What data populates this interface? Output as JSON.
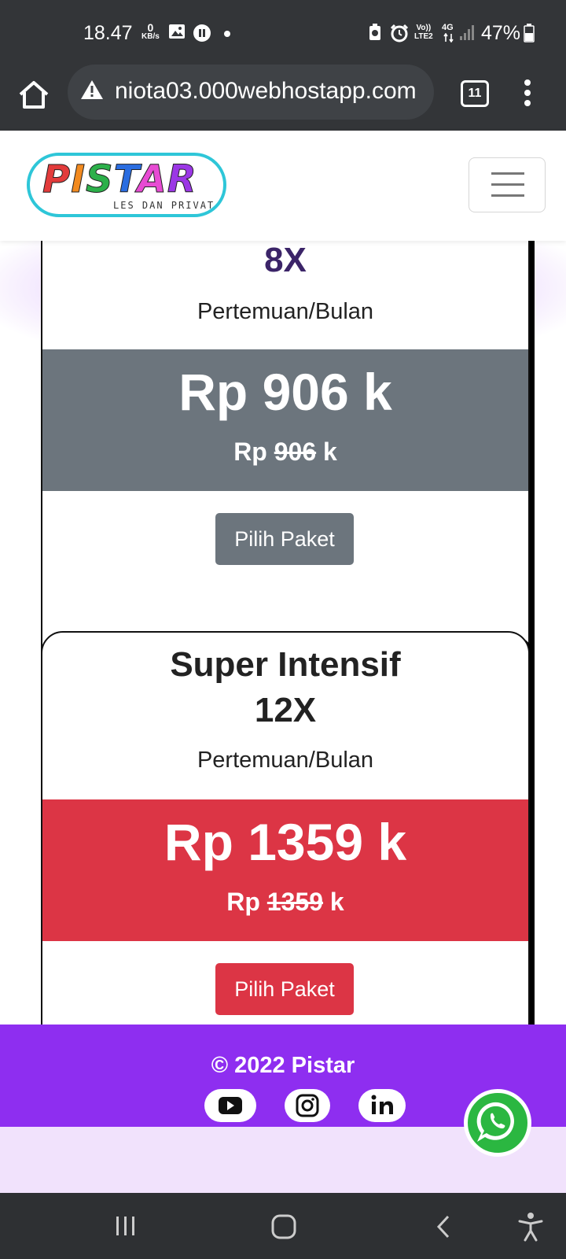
{
  "status_bar": {
    "time": "18.47",
    "speed_value": "0",
    "speed_unit": "KB/s",
    "network_volte": "Vo))",
    "network_lte": "LTE2",
    "network_type": "4G",
    "battery": "47%"
  },
  "browser": {
    "url": "niota03.000webhostapp.com",
    "tab_count": "11"
  },
  "brand": {
    "logo_text": "PISTAR",
    "logo_subtitle": "LES DAN PRIVAT",
    "logo_colors": [
      "#e23b3b",
      "#f28a1f",
      "#2cb04a",
      "#2a6de0",
      "#e74bd3",
      "#9b37e5"
    ]
  },
  "packages": [
    {
      "frequency": "8X",
      "unit": "Pertemuan/Bulan",
      "price_main": "Rp 906 k",
      "price_prefix": "Rp",
      "price_struck": "906",
      "price_suffix": "k",
      "button_label": "Pilih Paket",
      "band_color": "#6c757d"
    },
    {
      "name": "Super Intensif",
      "frequency": "12X",
      "unit": "Pertemuan/Bulan",
      "price_main": "Rp 1359 k",
      "price_prefix": "Rp",
      "price_struck": "1359",
      "price_suffix": "k",
      "button_label": "Pilih Paket",
      "band_color": "#dc3545"
    }
  ],
  "footer": {
    "copyright": "© 2022 Pistar",
    "social_icons": [
      "youtube-icon",
      "instagram-icon",
      "linkedin-icon"
    ],
    "background": "#8e2ef0"
  },
  "whatsapp_icon": "whatsapp-icon"
}
